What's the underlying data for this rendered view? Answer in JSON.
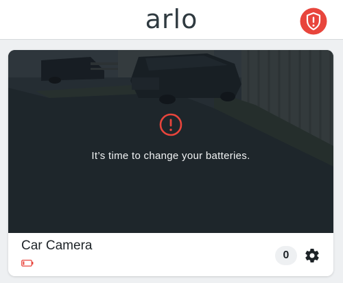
{
  "header": {
    "logo_text": "arlo",
    "security_icon": "shield-alert-icon"
  },
  "camera_card": {
    "alert_icon": "exclamation-circle-icon",
    "alert_message": "It’s time to change your batteries.",
    "camera_name": "Car Camera",
    "battery_icon": "low-battery-icon",
    "event_count": "0",
    "settings_icon": "gear-icon"
  },
  "colors": {
    "accent_red": "#e8453c",
    "text_dark": "#1d2327",
    "background": "#eef0f2"
  }
}
